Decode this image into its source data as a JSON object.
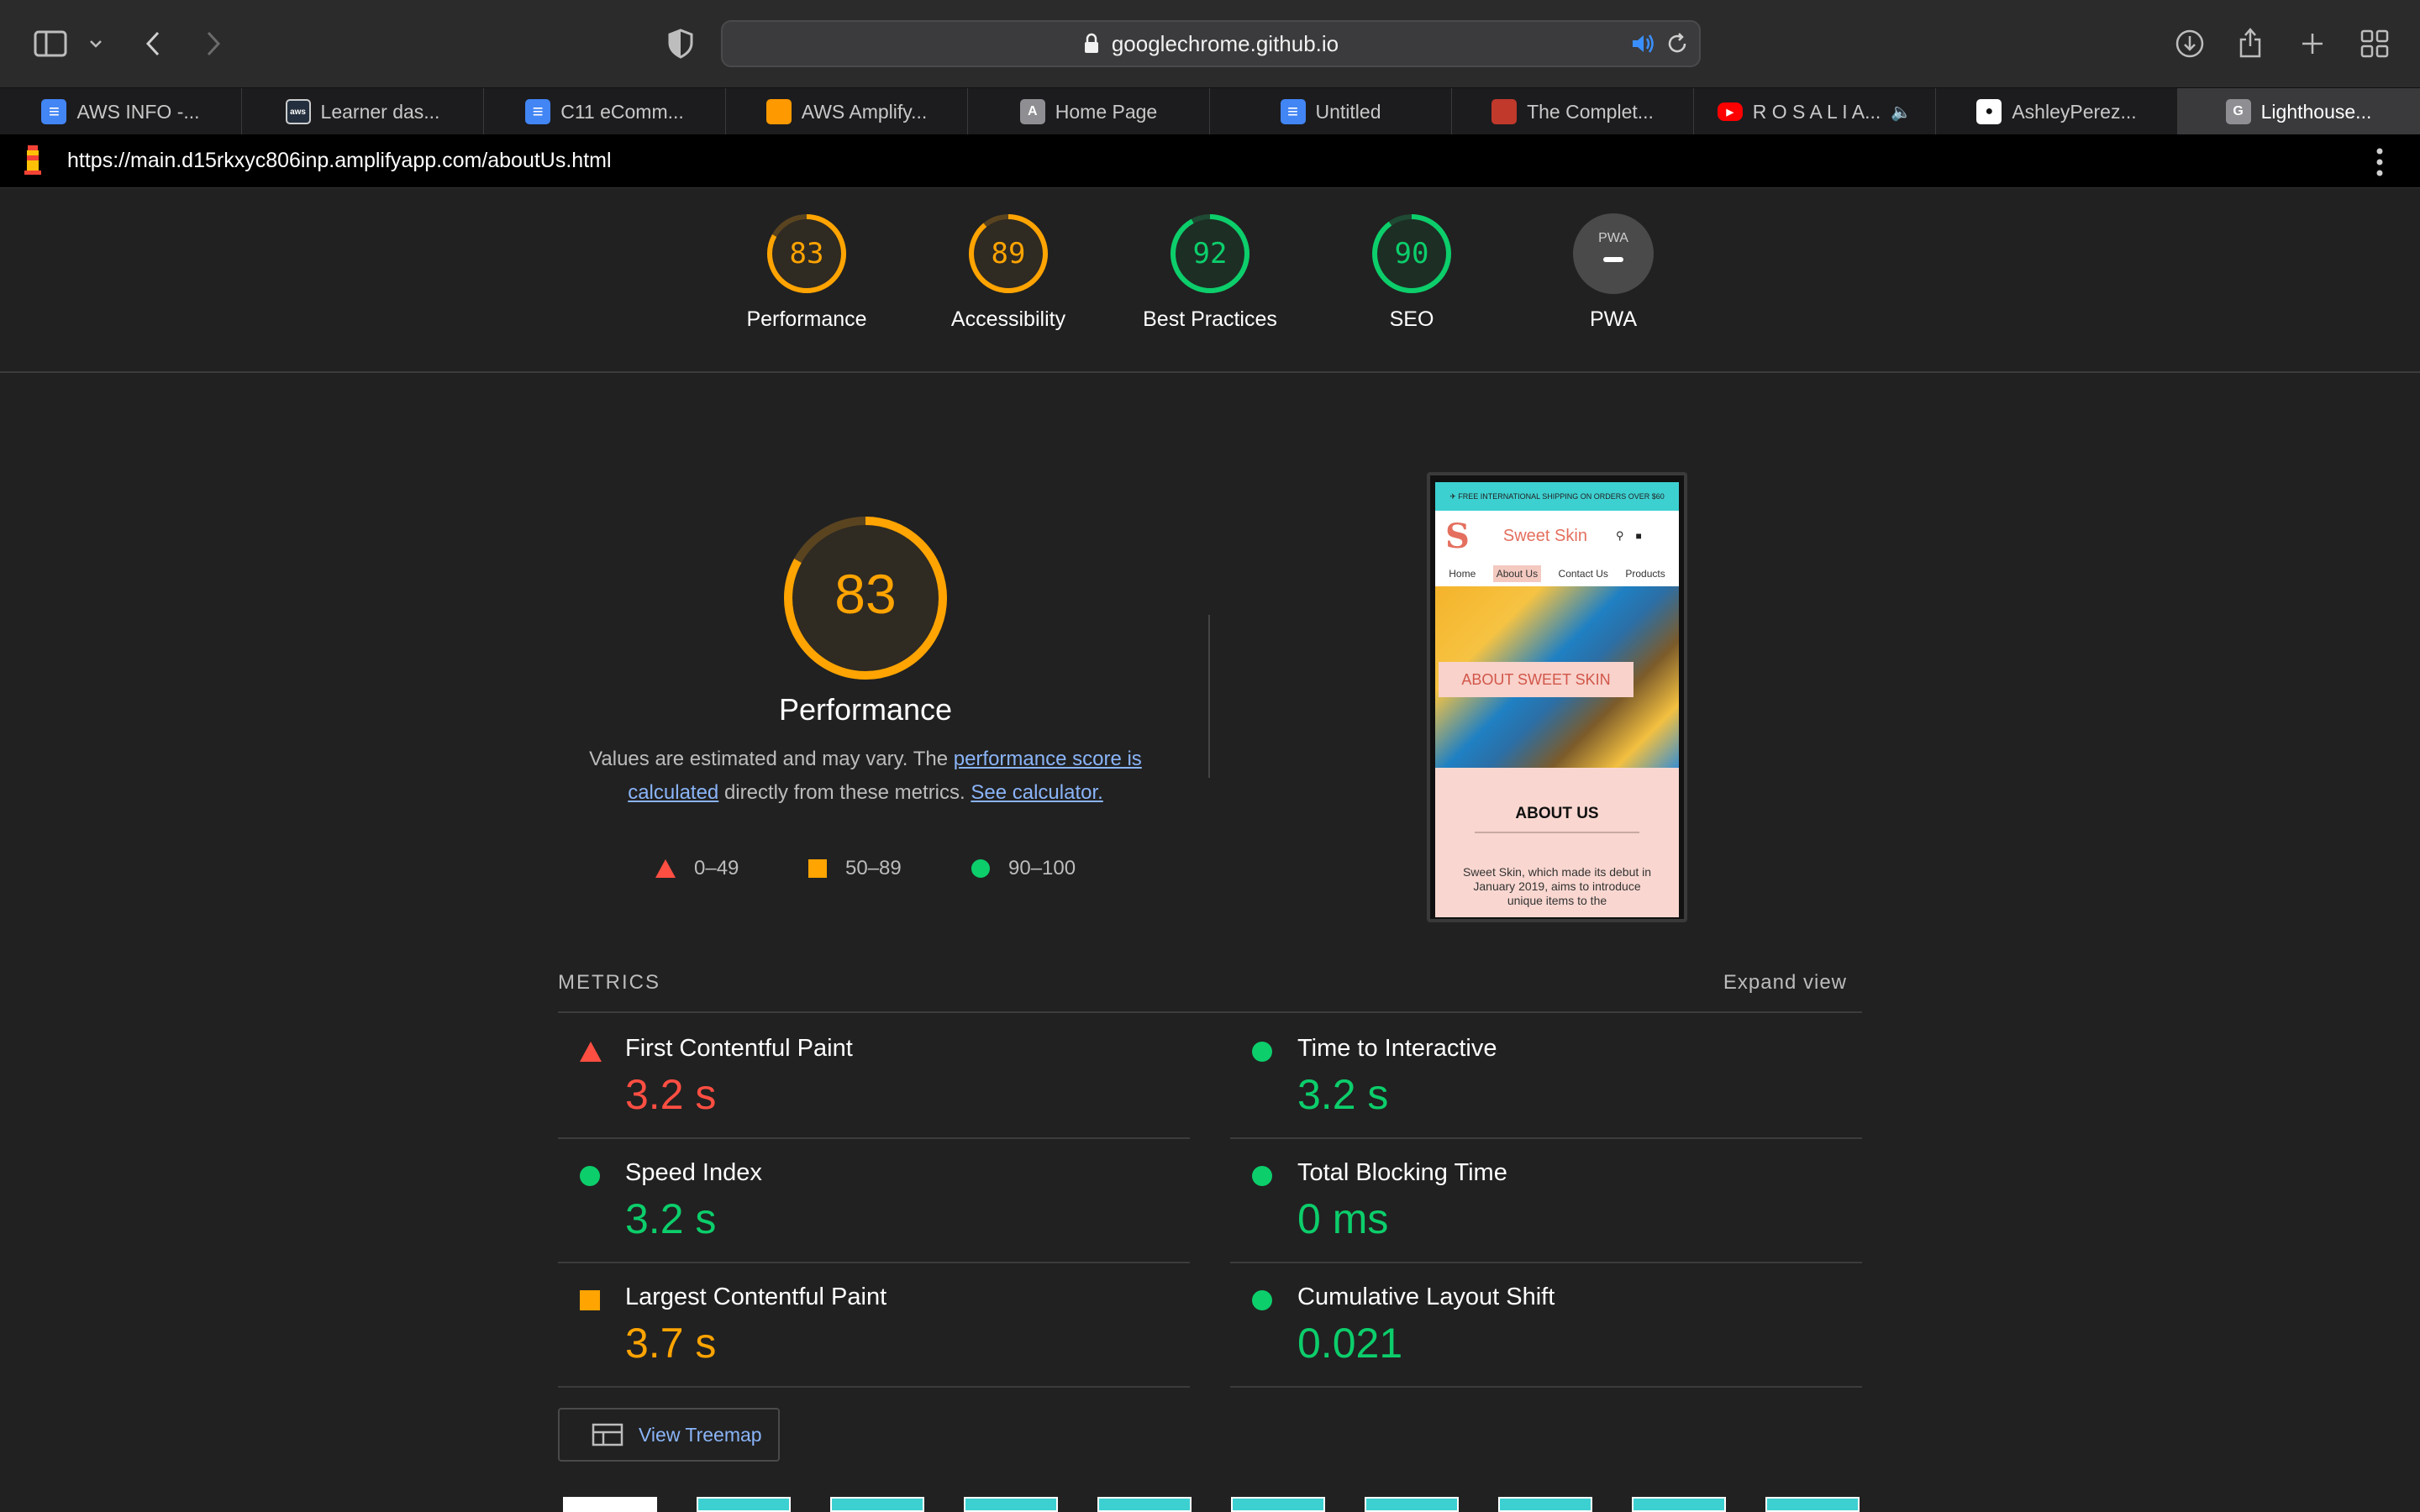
{
  "browser": {
    "domain": "googlechrome.github.io",
    "tabs": [
      {
        "label": "AWS INFO -...",
        "icon": "docs-icon",
        "color": "#4285f4"
      },
      {
        "label": "Learner das...",
        "icon": "aws-icon",
        "color": "#232f3e"
      },
      {
        "label": "C11 eComm...",
        "icon": "docs-icon",
        "color": "#4285f4"
      },
      {
        "label": "AWS Amplify...",
        "icon": "amplify-icon",
        "color": "#ff9900"
      },
      {
        "label": "Home Page",
        "icon": "letter-a-icon",
        "color": "#8e8e93"
      },
      {
        "label": "Untitled",
        "icon": "docs-icon",
        "color": "#4285f4"
      },
      {
        "label": "The Complet...",
        "icon": "site-icon",
        "color": "#c0392b"
      },
      {
        "label": "R O S A L I A...",
        "icon": "youtube-icon",
        "color": "#ff0000"
      },
      {
        "label": "AshleyPerez...",
        "icon": "github-icon",
        "color": "#ffffff"
      },
      {
        "label": "Lighthouse...",
        "icon": "letter-g-icon",
        "color": "#8e8e93"
      }
    ],
    "lighthouse_url": "https://main.d15rkxyc806inp.amplifyapp.com/aboutUs.html"
  },
  "gauges": [
    {
      "score": "83",
      "value": 0.83,
      "label": "Performance",
      "color": "#ffa400"
    },
    {
      "score": "89",
      "value": 0.89,
      "label": "Accessibility",
      "color": "#ffa400"
    },
    {
      "score": "92",
      "value": 0.92,
      "label": "Best Practices",
      "color": "#0cce6b"
    },
    {
      "score": "90",
      "value": 0.9,
      "label": "SEO",
      "color": "#0cce6b"
    },
    {
      "score": "PWA",
      "value": 0,
      "label": "PWA",
      "color": "#9e9e9e"
    }
  ],
  "performance": {
    "score": "83",
    "value": 0.83,
    "title": "Performance",
    "desc_prefix": "Values are estimated and may vary. The ",
    "desc_link1": "performance score is calculated",
    "desc_mid": " directly from these metrics. ",
    "desc_link2": "See calculator."
  },
  "legend": [
    {
      "range": "0–49",
      "shape": "triangle",
      "color": "#ff4e42"
    },
    {
      "range": "50–89",
      "shape": "square",
      "color": "#ffa400"
    },
    {
      "range": "90–100",
      "shape": "circle",
      "color": "#0cce6b"
    }
  ],
  "screenshot": {
    "shipping": "✈ FREE INTERNATIONAL SHIPPING ON ORDERS OVER $60",
    "logo": "S",
    "brand": "Sweet Skin",
    "nav": [
      "Home",
      "About Us",
      "Contact Us",
      "Products"
    ],
    "hero_band": "ABOUT SWEET SKIN",
    "about_heading": "ABOUT US",
    "about_text": "Sweet Skin, which made its debut in January 2019, aims to introduce unique items to the"
  },
  "metrics": {
    "heading": "METRICS",
    "expand": "Expand view",
    "items": [
      {
        "name": "First Contentful Paint",
        "value": "3.2 s",
        "status": "red"
      },
      {
        "name": "Time to Interactive",
        "value": "3.2 s",
        "status": "green"
      },
      {
        "name": "Speed Index",
        "value": "3.2 s",
        "status": "green"
      },
      {
        "name": "Total Blocking Time",
        "value": "0 ms",
        "status": "green"
      },
      {
        "name": "Largest Contentful Paint",
        "value": "3.7 s",
        "status": "orange"
      },
      {
        "name": "Cumulative Layout Shift",
        "value": "0.021",
        "status": "green"
      }
    ]
  },
  "treemap_label": "View Treemap"
}
